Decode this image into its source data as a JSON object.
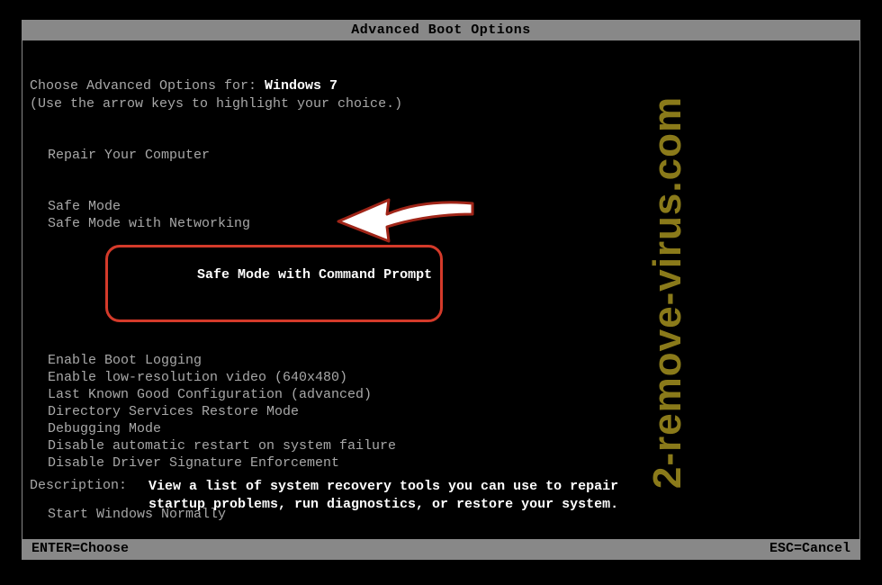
{
  "title": "Advanced Boot Options",
  "choose_prefix": "Choose Advanced Options for: ",
  "os_name": "Windows 7",
  "hint": "(Use the arrow keys to highlight your choice.)",
  "menu": {
    "repair": "Repair Your Computer",
    "safe_mode": "Safe Mode",
    "safe_mode_net": "Safe Mode with Networking",
    "safe_mode_cmd": "Safe Mode with Command Prompt",
    "boot_logging": "Enable Boot Logging",
    "low_res": "Enable low-resolution video (640x480)",
    "last_known": "Last Known Good Configuration (advanced)",
    "ds_restore": "Directory Services Restore Mode",
    "debugging": "Debugging Mode",
    "disable_restart": "Disable automatic restart on system failure",
    "disable_driver_sig": "Disable Driver Signature Enforcement",
    "start_normally": "Start Windows Normally"
  },
  "description": {
    "label": "Description:",
    "text": "View a list of system recovery tools you can use to repair\nstartup problems, run diagnostics, or restore your system."
  },
  "footer": {
    "enter": "ENTER=Choose",
    "esc": "ESC=Cancel"
  },
  "watermark": "2-remove-virus.com",
  "colors": {
    "highlight_border": "#d43a2a",
    "watermark": "#8a7a1a"
  }
}
